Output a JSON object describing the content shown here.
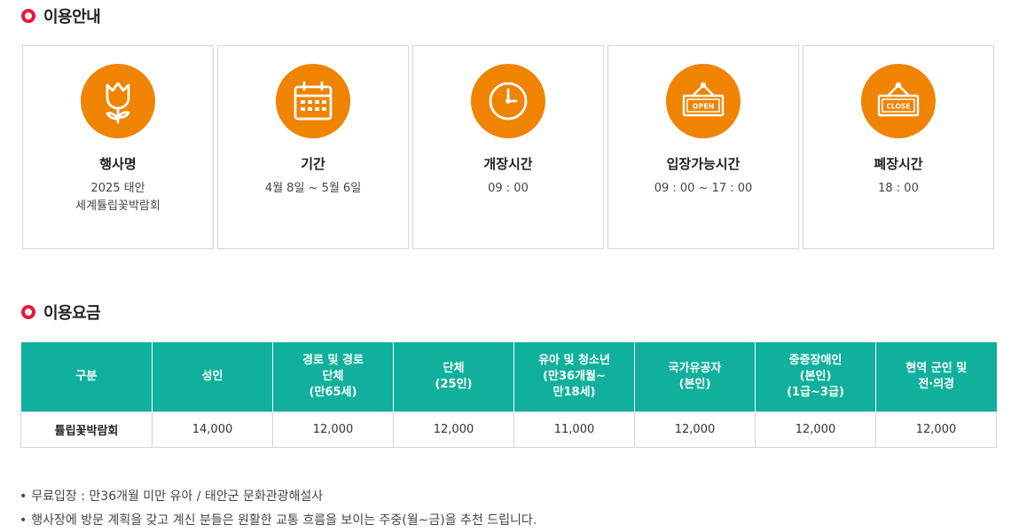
{
  "info_section": {
    "title": "이용안내",
    "cards": [
      {
        "icon": "tulip-icon",
        "label": "행사명",
        "value": "2025 태안\n세계튤립꽃박람회"
      },
      {
        "icon": "calendar-icon",
        "label": "기간",
        "value": "4월 8일 ~ 5월 6일"
      },
      {
        "icon": "clock-icon",
        "label": "개장시간",
        "value": "09 : 00"
      },
      {
        "icon": "open-sign-icon",
        "label": "입장가능시간",
        "value": "09 : 00 ~ 17 : 00",
        "sign_text": "OPEN"
      },
      {
        "icon": "close-sign-icon",
        "label": "폐장시간",
        "value": "18 : 00",
        "sign_text": "CLOSE"
      }
    ]
  },
  "fee_section": {
    "title": "이용요금",
    "headers": [
      "구분",
      "성인",
      "경로 및 경로\n단체\n(만65세)",
      "단체\n(25인)",
      "유아 및 청소년\n(만36개월~\n만18세)",
      "국가유공자\n(본인)",
      "중증장애인\n(본인)\n(1급~3급)",
      "현역 군인 및\n전·의경"
    ],
    "rows": [
      [
        "튤립꽃박람회",
        "14,000",
        "12,000",
        "12,000",
        "11,000",
        "12,000",
        "12,000",
        "12,000"
      ]
    ]
  },
  "notes": [
    "무료입장 : 만36개월 미만 유아 / 태안군 문화관광해설사",
    "행사장에 방문 계획을 갖고 계신 분들은 원활한 교통 흐름을 보이는 주중(월~금)을 추천 드립니다."
  ],
  "colors": {
    "accent_orange": "#f08300",
    "table_header": "#10b09c",
    "bullet_red": "#e8173a"
  }
}
